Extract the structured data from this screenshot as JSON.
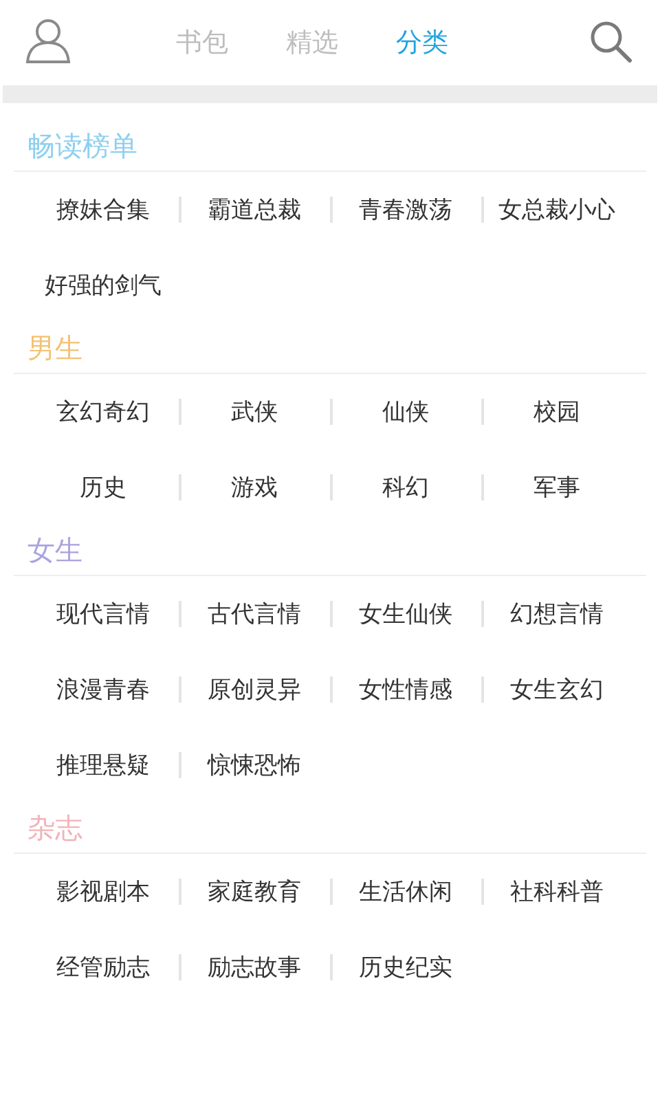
{
  "header": {
    "tabs": [
      {
        "label": "书包",
        "selected": false
      },
      {
        "label": "精选",
        "selected": false
      },
      {
        "label": "分类",
        "selected": true
      }
    ]
  },
  "sections": [
    {
      "title": "畅读榜单",
      "color": "#8ed0ee",
      "items": [
        "撩妹合集",
        "霸道总裁",
        "青春激荡",
        "女总裁小心",
        "好强的剑气"
      ]
    },
    {
      "title": "男生",
      "color": "#f3c274",
      "items": [
        "玄幻奇幻",
        "武侠",
        "仙侠",
        "校园",
        "历史",
        "游戏",
        "科幻",
        "军事"
      ]
    },
    {
      "title": "女生",
      "color": "#aaa3de",
      "items": [
        "现代言情",
        "古代言情",
        "女生仙侠",
        "幻想言情",
        "浪漫青春",
        "原创灵异",
        "女性情感",
        "女生玄幻",
        "推理悬疑",
        "惊悚恐怖"
      ]
    },
    {
      "title": "杂志",
      "color": "#f2b3ba",
      "items": [
        "影视剧本",
        "家庭教育",
        "生活休闲",
        "社科科普",
        "经管励志",
        "励志故事",
        "历史纪实"
      ]
    }
  ]
}
